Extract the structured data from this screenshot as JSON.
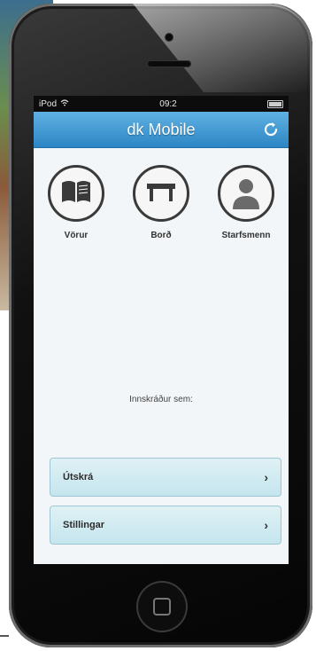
{
  "status_bar": {
    "carrier": "iPod",
    "time": "09:2"
  },
  "app": {
    "title": "dk Mobile"
  },
  "tiles": [
    {
      "label": "Vörur",
      "icon": "book-icon"
    },
    {
      "label": "Borð",
      "icon": "table-icon"
    },
    {
      "label": "Starfsmenn",
      "icon": "person-icon"
    }
  ],
  "logged_in_label": "Innskráður sem:",
  "menu": [
    {
      "label": "Útskrá"
    },
    {
      "label": "Stillingar"
    }
  ],
  "colors": {
    "navbar_top": "#5fb1e2",
    "navbar_bottom": "#2d86c4",
    "button_bg": "#d4ecf2"
  }
}
